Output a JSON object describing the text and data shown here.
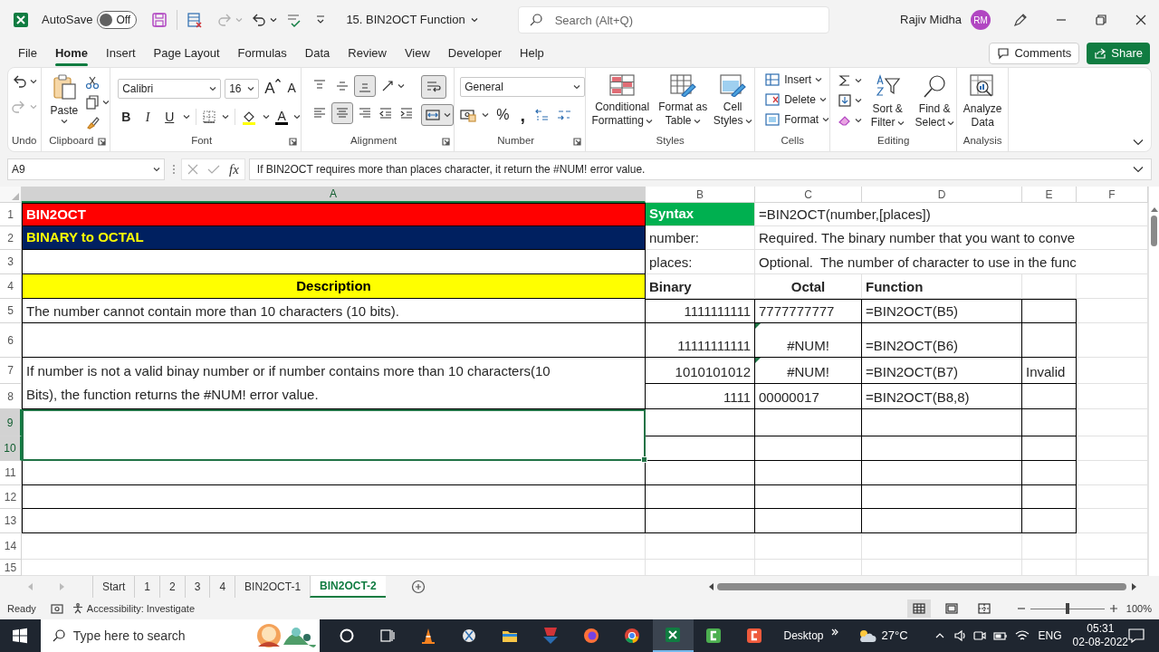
{
  "title_bar": {
    "autosave_label": "AutoSave",
    "autosave_toggle": {
      "on": false,
      "text": "Off"
    },
    "document_title": "15. BIN2OCT Function",
    "search_placeholder": "Search (Alt+Q)",
    "user_name": "Rajiv Midha",
    "avatar_initials": "RM"
  },
  "menu_tabs": [
    {
      "label": "File",
      "selected": false
    },
    {
      "label": "Home",
      "selected": true
    },
    {
      "label": "Insert",
      "selected": false
    },
    {
      "label": "Page Layout",
      "selected": false
    },
    {
      "label": "Formulas",
      "selected": false
    },
    {
      "label": "Data",
      "selected": false
    },
    {
      "label": "Review",
      "selected": false
    },
    {
      "label": "View",
      "selected": false
    },
    {
      "label": "Developer",
      "selected": false
    },
    {
      "label": "Help",
      "selected": false
    }
  ],
  "comments_button": "Comments",
  "share_button": "Share",
  "ribbon": {
    "undo_group": "Undo",
    "clipboard_group": "Clipboard",
    "paste": "Paste",
    "font_group": "Font",
    "font_name": "Calibri",
    "font_size": "16",
    "grow_font": "A",
    "shrink_font": "A",
    "bold": "B",
    "italic": "I",
    "underline": "U",
    "font_color": "A",
    "alignment_group": "Alignment",
    "vertical_align": [
      {
        "selected": false
      },
      {
        "selected": false
      },
      {
        "selected": true
      }
    ],
    "horizontal_align": [
      {
        "selected": false
      },
      {
        "selected": true
      },
      {
        "selected": false
      }
    ],
    "wrap_text": {
      "selected": true
    },
    "merge_center": {
      "selected": true
    },
    "number_group": "Number",
    "number_format": "General",
    "percent": "%",
    "comma": ",",
    "styles_group": "Styles",
    "conditional_formatting": "Conditional Formatting",
    "format_as_table": "Format as Table",
    "cell_styles": "Cell Styles",
    "cells_group": "Cells",
    "insert": "Insert",
    "delete": "Delete",
    "format": "Format",
    "editing_group": "Editing",
    "sort_filter": "Sort & Filter",
    "find_select": "Find & Select",
    "analysis_group": "Analysis",
    "analyze_data": "Analyze Data"
  },
  "formula_bar": {
    "name_box": "A9",
    "fx": "fx",
    "formula": "If BIN2OCT requires more than places character, it return the #NUM! error value."
  },
  "sheet": {
    "columns": [
      {
        "label": "A",
        "selected": true
      },
      {
        "label": "B",
        "selected": false
      },
      {
        "label": "C",
        "selected": false
      },
      {
        "label": "D",
        "selected": false
      },
      {
        "label": "E",
        "selected": false
      },
      {
        "label": "F",
        "selected": false
      }
    ],
    "rows": [
      {
        "number": "1",
        "selected": false,
        "cells": [
          {
            "kind": "title",
            "text": "BIN2OCT"
          },
          {
            "kind": "syntax",
            "text": "Syntax"
          },
          {
            "kind": "label",
            "text": "=BIN2OCT(number,[places])"
          },
          {
            "kind": "empty"
          },
          {
            "kind": "empty"
          },
          {
            "kind": "empty"
          }
        ]
      },
      {
        "number": "2",
        "selected": false,
        "cells": [
          {
            "kind": "subtitle",
            "text": "BINARY to OCTAL"
          },
          {
            "kind": "label",
            "text": "number:"
          },
          {
            "kind": "label",
            "text": "Required. The binary number that you want to conve"
          },
          {
            "kind": "empty"
          },
          {
            "kind": "empty"
          },
          {
            "kind": "empty"
          }
        ]
      },
      {
        "number": "3",
        "selected": false,
        "cells": [
          {
            "kind": "boxed_empty"
          },
          {
            "kind": "label",
            "text": "places:"
          },
          {
            "kind": "label",
            "text": "Optional.  The number of character to use in the func"
          },
          {
            "kind": "empty"
          },
          {
            "kind": "empty"
          },
          {
            "kind": "empty"
          }
        ]
      },
      {
        "number": "4",
        "selected": false,
        "cells": [
          {
            "kind": "header",
            "text": "Description"
          },
          {
            "kind": "label_bold",
            "text": "Binary"
          },
          {
            "kind": "label_bold_center",
            "text": "Octal"
          },
          {
            "kind": "label_bold",
            "text": "Function"
          },
          {
            "kind": "empty"
          },
          {
            "kind": "empty"
          }
        ]
      },
      {
        "number": "5",
        "selected": false,
        "cells": [
          {
            "kind": "text",
            "text": "The number cannot contain more than 10 characters (10 bits)."
          },
          {
            "kind": "number",
            "text": "1111111111"
          },
          {
            "kind": "text",
            "text": "7777777777"
          },
          {
            "kind": "text",
            "text": "=BIN2OCT(B5)"
          },
          {
            "kind": "boxed_empty"
          },
          {
            "kind": "empty"
          }
        ]
      },
      {
        "number": "6",
        "selected": false,
        "cells": [
          {
            "kind": "boxed_empty"
          },
          {
            "kind": "number",
            "text": "11111111111"
          },
          {
            "kind": "centered",
            "text": "#NUM!",
            "error_flag": true
          },
          {
            "kind": "text",
            "text": "=BIN2OCT(B6)"
          },
          {
            "kind": "boxed_empty"
          },
          {
            "kind": "empty"
          }
        ]
      },
      {
        "number": "7",
        "selected": false,
        "cells": [
          {
            "kind": "text",
            "text": "If number is not a valid binay number  or if number contains more than 10 characters(10 Bits), the function returns the #NUM! error value.",
            "merged_down": true
          },
          {
            "kind": "number",
            "text": "1010101012"
          },
          {
            "kind": "centered",
            "text": "#NUM!",
            "error_flag": true
          },
          {
            "kind": "text",
            "text": "=BIN2OCT(B7)"
          },
          {
            "kind": "text",
            "text": "Invalid"
          },
          {
            "kind": "empty"
          }
        ]
      },
      {
        "number": "8",
        "selected": false,
        "cells": [
          {
            "kind": "merged"
          },
          {
            "kind": "number",
            "text": "1111"
          },
          {
            "kind": "text",
            "text": "00000017"
          },
          {
            "kind": "text",
            "text": "=BIN2OCT(B8,8)"
          },
          {
            "kind": "boxed_empty"
          },
          {
            "kind": "empty"
          }
        ]
      },
      {
        "number": "9",
        "selected": true,
        "cells": [
          {
            "kind": "boxed_empty",
            "merged_down": true
          },
          {
            "kind": "boxed_empty"
          },
          {
            "kind": "boxed_empty"
          },
          {
            "kind": "boxed_empty"
          },
          {
            "kind": "boxed_empty"
          },
          {
            "kind": "empty"
          }
        ]
      },
      {
        "number": "10",
        "selected": true,
        "cells": [
          {
            "kind": "merged"
          },
          {
            "kind": "boxed_empty"
          },
          {
            "kind": "boxed_empty"
          },
          {
            "kind": "boxed_empty"
          },
          {
            "kind": "boxed_empty"
          },
          {
            "kind": "empty"
          }
        ]
      },
      {
        "number": "11",
        "selected": false,
        "cells": [
          {
            "kind": "boxed_empty"
          },
          {
            "kind": "boxed_empty"
          },
          {
            "kind": "boxed_empty"
          },
          {
            "kind": "boxed_empty"
          },
          {
            "kind": "boxed_empty"
          },
          {
            "kind": "empty"
          }
        ]
      },
      {
        "number": "12",
        "selected": false,
        "cells": [
          {
            "kind": "boxed_empty"
          },
          {
            "kind": "boxed_empty"
          },
          {
            "kind": "boxed_empty"
          },
          {
            "kind": "boxed_empty"
          },
          {
            "kind": "boxed_empty"
          },
          {
            "kind": "empty"
          }
        ]
      },
      {
        "number": "13",
        "selected": false,
        "cells": [
          {
            "kind": "boxed_empty"
          },
          {
            "kind": "boxed_empty"
          },
          {
            "kind": "boxed_empty"
          },
          {
            "kind": "boxed_empty"
          },
          {
            "kind": "boxed_empty"
          },
          {
            "kind": "empty"
          }
        ]
      },
      {
        "number": "14",
        "selected": false,
        "cells": [
          {
            "kind": "empty"
          },
          {
            "kind": "empty"
          },
          {
            "kind": "empty"
          },
          {
            "kind": "empty"
          },
          {
            "kind": "empty"
          },
          {
            "kind": "empty"
          }
        ]
      },
      {
        "number": "15",
        "selected": false,
        "cells": [
          {
            "kind": "empty"
          },
          {
            "kind": "empty"
          },
          {
            "kind": "empty"
          },
          {
            "kind": "empty"
          },
          {
            "kind": "empty"
          },
          {
            "kind": "empty"
          }
        ]
      }
    ]
  },
  "sheet_tabs": [
    {
      "label": "Start",
      "selected": false
    },
    {
      "label": "1",
      "selected": false
    },
    {
      "label": "2",
      "selected": false
    },
    {
      "label": "3",
      "selected": false
    },
    {
      "label": "4",
      "selected": false
    },
    {
      "label": "BIN2OCT-1",
      "selected": false
    },
    {
      "label": "BIN2OCT-2",
      "selected": true
    }
  ],
  "status_bar": {
    "ready": "Ready",
    "accessibility": "Accessibility: Investigate",
    "views": [
      {
        "selected": true
      },
      {
        "selected": false
      },
      {
        "selected": false
      }
    ],
    "zoom_slider": {
      "level": 0.5
    },
    "zoom": "100%"
  },
  "taskbar": {
    "search_placeholder": "Type here to search",
    "apps": [
      {
        "kind": "cortana",
        "active": false
      },
      {
        "kind": "task_view",
        "active": false
      },
      {
        "kind": "cone",
        "active": false
      },
      {
        "kind": "snip",
        "active": false
      },
      {
        "kind": "folder",
        "active": false
      },
      {
        "kind": "pen",
        "active": false
      },
      {
        "kind": "firefox",
        "active": false
      },
      {
        "kind": "chrome",
        "active": false
      },
      {
        "kind": "excel",
        "active": true
      },
      {
        "kind": "recorder",
        "active": false
      },
      {
        "kind": "editor",
        "active": false
      }
    ],
    "desktop": "Desktop",
    "temperature": "27°C",
    "language": "ENG",
    "time": "05:31",
    "date": "02-08-2022"
  }
}
